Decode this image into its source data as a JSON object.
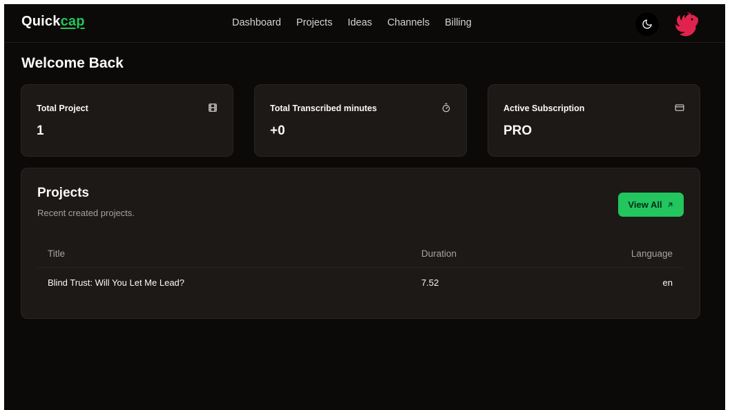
{
  "header": {
    "logo_main": "Quick",
    "logo_accent": "cap",
    "nav": [
      "Dashboard",
      "Projects",
      "Ideas",
      "Channels",
      "Billing"
    ],
    "accent_color": "#22c55e",
    "avatar_color": "#e0234e"
  },
  "page": {
    "title": "Welcome Back"
  },
  "stats": [
    {
      "label": "Total Project",
      "value": "1",
      "icon": "film-icon"
    },
    {
      "label": "Total Transcribed minutes",
      "value": "+0",
      "icon": "timer-icon"
    },
    {
      "label": "Active Subscription",
      "value": "PRO",
      "icon": "credit-card-icon"
    }
  ],
  "projects": {
    "title": "Projects",
    "subtitle": "Recent created projects.",
    "view_all": "View All",
    "columns": [
      "Title",
      "Duration",
      "Language"
    ],
    "rows": [
      {
        "title": "Blind Trust: Will You Let Me Lead?",
        "duration": "7.52",
        "language": "en"
      }
    ]
  }
}
